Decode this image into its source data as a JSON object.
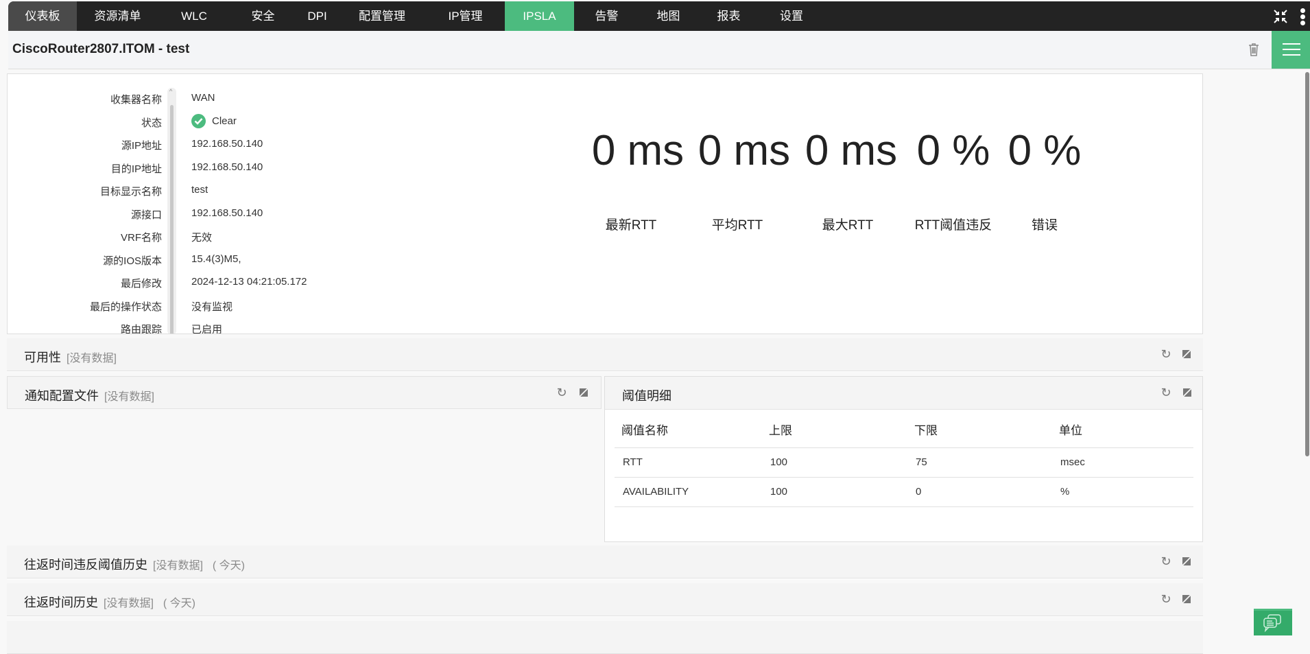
{
  "nav": {
    "items": [
      "仪表板",
      "资源清单",
      "WLC",
      "安全",
      "DPI",
      "配置管理",
      "IP管理",
      "IPSLA",
      "告警",
      "地图",
      "报表",
      "设置"
    ],
    "active": "仪表板",
    "highlighted": "IPSLA"
  },
  "header": {
    "title": "CiscoRouter2807.ITOM - test"
  },
  "info": {
    "rows": [
      {
        "label": "收集器名称",
        "value": "WAN"
      },
      {
        "label": "状态",
        "value": "Clear"
      },
      {
        "label": "源IP地址",
        "value": "192.168.50.140"
      },
      {
        "label": "目的IP地址",
        "value": "192.168.50.140"
      },
      {
        "label": "目标显示名称",
        "value": "test"
      },
      {
        "label": "源接口",
        "value": "192.168.50.140"
      },
      {
        "label": "VRF名称",
        "value": "无效"
      },
      {
        "label": "源的IOS版本",
        "value": "15.4(3)M5,"
      },
      {
        "label": "最后修改",
        "value": "2024-12-13 04:21:05.172"
      },
      {
        "label": "最后的操作状态",
        "value": "没有监视"
      },
      {
        "label": "路由跟踪",
        "value": "已启用"
      }
    ]
  },
  "metrics": [
    {
      "value": "0 ms",
      "label": "最新RTT"
    },
    {
      "value": "0 ms",
      "label": "平均RTT"
    },
    {
      "value": "0 ms",
      "label": "最大RTT"
    },
    {
      "value": "0 %",
      "label": "RTT阈值违反"
    },
    {
      "value": "0 %",
      "label": "错误"
    }
  ],
  "panels": {
    "availability": {
      "title": "可用性",
      "status": "[没有数据]"
    },
    "notification": {
      "title": "通知配置文件",
      "status": "[没有数据]"
    },
    "threshold": {
      "title": "阈值明细",
      "columns": [
        "阈值名称",
        "上限",
        "下限",
        "单位"
      ],
      "rows": [
        [
          "RTT",
          "100",
          "75",
          "msec"
        ],
        [
          "AVAILABILITY",
          "100",
          "0",
          "%"
        ]
      ]
    },
    "rtt_violation_history": {
      "title": "往返时间违反阈值历史",
      "status": "[没有数据]",
      "period": "( 今天)"
    },
    "rtt_history": {
      "title": "往返时间历史",
      "status": "[没有数据]",
      "period": "( 今天)"
    }
  },
  "colors": {
    "accent": "#4cbb7f",
    "nav_bg": "#232323"
  }
}
